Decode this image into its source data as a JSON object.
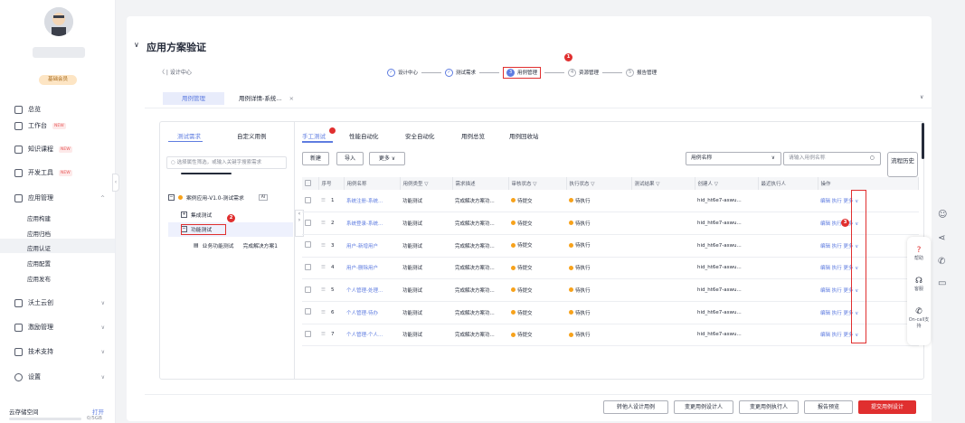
{
  "sidebar": {
    "member_label": "基础会员",
    "items": [
      {
        "label": "总览",
        "icon": "overview-icon",
        "new": false
      },
      {
        "label": "工作台",
        "icon": "workbench-icon",
        "new": true
      },
      {
        "label": "知识课程",
        "icon": "course-icon",
        "new": true
      },
      {
        "label": "开发工具",
        "icon": "devtools-icon",
        "new": true
      },
      {
        "label": "应用管理",
        "icon": "app-icon",
        "new": false
      }
    ],
    "new_tag": "NEW",
    "sub_items": [
      "应用构建",
      "应用归档",
      "应用认证",
      "应用配置",
      "应用发布"
    ],
    "lower_items": [
      {
        "label": "沃土云创",
        "icon": "cloud-icon"
      },
      {
        "label": "激励管理",
        "icon": "incentive-icon"
      },
      {
        "label": "技术支持",
        "icon": "support-icon"
      },
      {
        "label": "设置",
        "icon": "settings-icon"
      }
    ],
    "storage_label": "云存储空间",
    "storage_action": "打开",
    "storage_size": "0/5GB"
  },
  "header": {
    "title": "应用方案验证",
    "back_label": "〈 | 设计中心",
    "steps": [
      {
        "num": "✓",
        "label": "设计中心",
        "state": "done"
      },
      {
        "num": "✓",
        "label": "测试需求",
        "state": "done"
      },
      {
        "num": "3",
        "label": "用例管理",
        "state": "active"
      },
      {
        "num": "4",
        "label": "资源管理",
        "state": "pending"
      },
      {
        "num": "5",
        "label": "报告管理",
        "state": "pending"
      }
    ]
  },
  "page_tabs": [
    {
      "label": "用例管理"
    },
    {
      "label": "用例详情-系统..."
    }
  ],
  "close_glyph": "×",
  "left_panel": {
    "tabs": [
      "测试需求",
      "自定义用例"
    ],
    "search_placeholder": "选择属性筛选，或输入关键字搜索需求",
    "tree": {
      "root": "案例应用-V1.0-测试需求",
      "root_tag": "AI",
      "children": [
        "集成测试",
        "功能测试"
      ],
      "leaf_name": "业务功能测试",
      "leaf_desc": "完成解决方案1"
    }
  },
  "right_panel": {
    "tabs": [
      "手工测试",
      "性能自动化",
      "安全自动化",
      "用例总览",
      "用例回收站"
    ],
    "buttons": {
      "new": "新建",
      "import": "导入",
      "more": "更多 ∨"
    },
    "filter_select": "用例名称",
    "filter_placeholder": "请输入用例名称",
    "history": "流程历史",
    "columns": [
      "序号",
      "用例名称",
      "用例类型",
      "需求描述",
      "审核状态",
      "执行状态",
      "测试结果",
      "创建人",
      "最近执行人",
      "操作"
    ],
    "rows": [
      {
        "no": "1",
        "name": "系统注册-系统...",
        "type": "功能测试",
        "desc": "完成解决方案功...",
        "audit": "待提交",
        "exec": "待执行",
        "creator": "hid_ht6e7-aswu..."
      },
      {
        "no": "2",
        "name": "系统登录-系统...",
        "type": "功能测试",
        "desc": "完成解决方案功...",
        "audit": "待提交",
        "exec": "待执行",
        "creator": "hid_ht6e7-aswu..."
      },
      {
        "no": "3",
        "name": "用户-新增用户",
        "type": "功能测试",
        "desc": "完成解决方案功...",
        "audit": "待提交",
        "exec": "待执行",
        "creator": "hid_ht6e7-aswu..."
      },
      {
        "no": "4",
        "name": "用户-删除用户",
        "type": "功能测试",
        "desc": "完成解决方案功...",
        "audit": "待提交",
        "exec": "待执行",
        "creator": "hid_ht6e7-aswu..."
      },
      {
        "no": "5",
        "name": "个人管理-处理...",
        "type": "功能测试",
        "desc": "完成解决方案功...",
        "audit": "待提交",
        "exec": "待执行",
        "creator": "hid_ht6e7-aswu..."
      },
      {
        "no": "6",
        "name": "个人管理-待办",
        "type": "功能测试",
        "desc": "完成解决方案功...",
        "audit": "待提交",
        "exec": "待执行",
        "creator": "hid_ht6e7-aswu..."
      },
      {
        "no": "7",
        "name": "个人管理-个人...",
        "type": "功能测试",
        "desc": "完成解决方案功...",
        "audit": "待提交",
        "exec": "待执行",
        "creator": "hid_ht6e7-aswu..."
      }
    ],
    "ops": {
      "edit": "编辑",
      "run": "执行",
      "more": "更多 ∨"
    }
  },
  "footer_buttons": [
    "转他人设计用例",
    "变更用例设计人",
    "变更用例执行人",
    "报告预览",
    "提交用例设计"
  ],
  "float_help": [
    {
      "icon": "help-icon",
      "glyph": "?",
      "label": "帮助"
    },
    {
      "icon": "headset-icon",
      "glyph": "☊",
      "label": "客服"
    },
    {
      "icon": "phone-icon",
      "glyph": "✆",
      "label": "On-call支持"
    }
  ],
  "annotations": [
    "1",
    "2",
    "3"
  ],
  "colors": {
    "accent": "#5e7ce0",
    "danger": "#e02f2f",
    "warning": "#f7a21b"
  }
}
